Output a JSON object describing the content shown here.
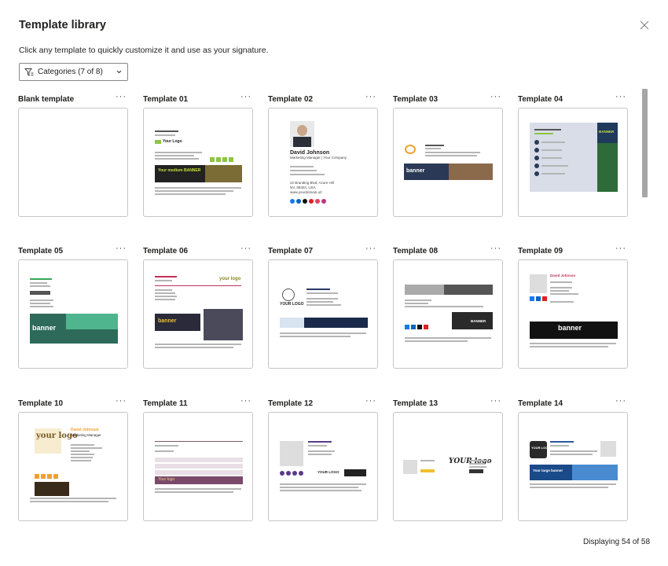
{
  "dialog": {
    "title": "Template library",
    "subtitle": "Click any template to quickly customize it and use as your signature.",
    "close_icon": "close-icon"
  },
  "filter": {
    "label": "Categories (7 of 8)",
    "icon": "filter-icon"
  },
  "templates": [
    {
      "name": "Blank template"
    },
    {
      "name": "Template 01"
    },
    {
      "name": "Template 02"
    },
    {
      "name": "Template 03"
    },
    {
      "name": "Template 04"
    },
    {
      "name": "Template 05"
    },
    {
      "name": "Template 06"
    },
    {
      "name": "Template 07"
    },
    {
      "name": "Template 08"
    },
    {
      "name": "Template 09"
    },
    {
      "name": "Template 10"
    },
    {
      "name": "Template 11"
    },
    {
      "name": "Template 12"
    },
    {
      "name": "Template 13"
    },
    {
      "name": "Template 14"
    }
  ],
  "more_label": "···",
  "preview": {
    "t02_name": "David Johnson",
    "t02_title": "Marketing Manager | Your Company",
    "t02_address1": "22 Branding Blvd, Azure Hill",
    "t02_address2": "NV, 89404, USA",
    "t02_web": "www.yourdomain.url",
    "t01_logo": "Your Logo",
    "t01_banner": "Your medium BANNER",
    "t03_banner": "banner",
    "t04_banner": "BANNER",
    "t05_banner": "banner",
    "t06_logo": "your logo",
    "t06_banner": "banner",
    "t07_logo": "YOUR LOGO",
    "t08_banner": "BANNER",
    "t09_name": "David Johnson",
    "t09_banner": "banner",
    "t10_logo": "your logo",
    "t10_name": "David Johnson",
    "t10_title": "Marketing Manager",
    "t11_logo": "Your logo",
    "t12_logo": "YOUR LOGO",
    "t13_logo": "YOUR logo",
    "t14_logo": "YOUR LOGO",
    "t14_banner": "Your large banner"
  },
  "footer": {
    "status": "Displaying 54 of 58"
  },
  "colors": {
    "border": "#c8c6c4",
    "text": "#201f1e",
    "scroll_thumb": "#a6a6a6"
  }
}
